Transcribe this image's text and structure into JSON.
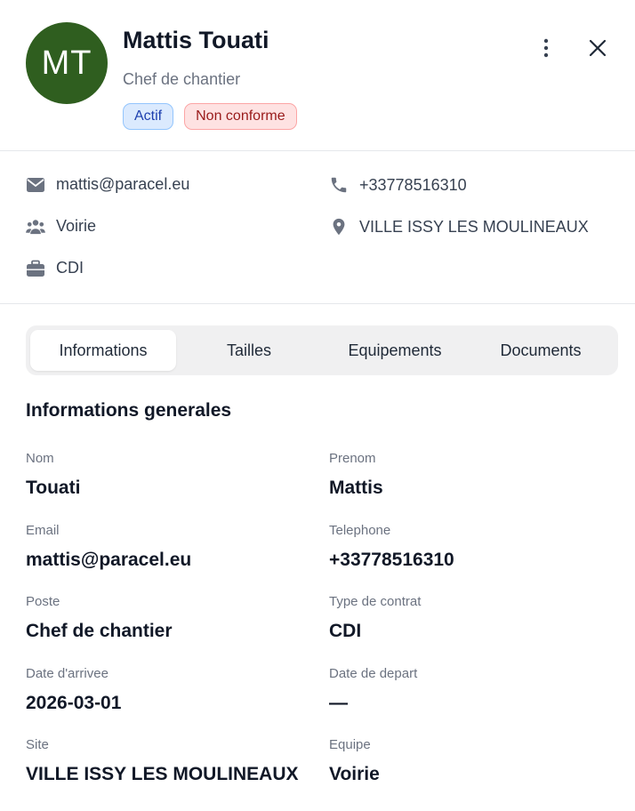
{
  "header": {
    "avatar_initials": "MT",
    "avatar_color": "#2f5e1f",
    "name": "Mattis Touati",
    "role": "Chef de chantier",
    "badges": [
      {
        "label": "Actif",
        "tone": "blue"
      },
      {
        "label": "Non conforme",
        "tone": "red"
      }
    ],
    "more_icon": "kebab-vertical-icon",
    "close_icon": "close-icon"
  },
  "contacts": {
    "email": "mattis@paracel.eu",
    "phone": "+33778516310",
    "team": "Voirie",
    "location": "VILLE ISSY LES MOULINEAUX",
    "contract": "CDI"
  },
  "tabs": [
    {
      "label": "Informations",
      "active": true
    },
    {
      "label": "Tailles",
      "active": false
    },
    {
      "label": "Equipements",
      "active": false
    },
    {
      "label": "Documents",
      "active": false
    }
  ],
  "section": {
    "title": "Informations generales",
    "fields": [
      {
        "label": "Nom",
        "value": "Touati"
      },
      {
        "label": "Prenom",
        "value": "Mattis"
      },
      {
        "label": "Email",
        "value": "mattis@paracel.eu"
      },
      {
        "label": "Telephone",
        "value": "+33778516310"
      },
      {
        "label": "Poste",
        "value": "Chef de chantier"
      },
      {
        "label": "Type de contrat",
        "value": "CDI"
      },
      {
        "label": "Date d'arrivee",
        "value": "2026-03-01"
      },
      {
        "label": "Date de depart",
        "value": "—"
      },
      {
        "label": "Site",
        "value": "VILLE ISSY LES MOULINEAUX"
      },
      {
        "label": "Equipe",
        "value": "Voirie"
      }
    ]
  }
}
